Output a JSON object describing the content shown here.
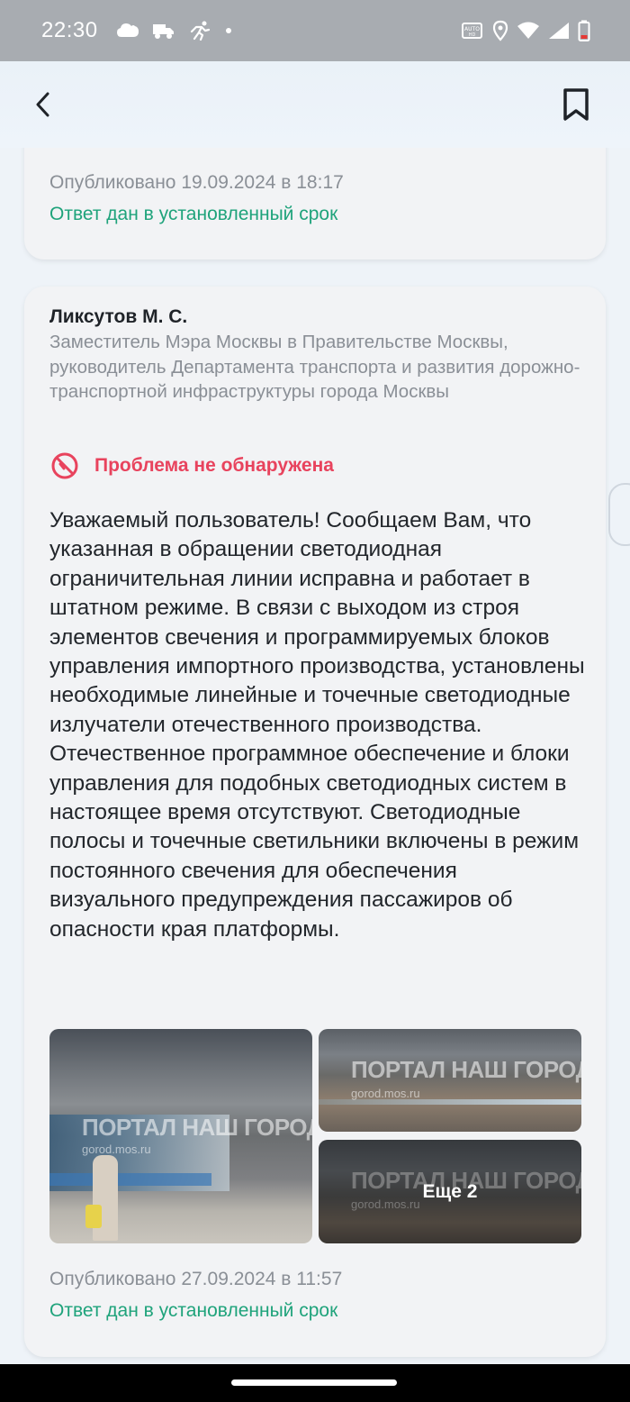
{
  "status_bar": {
    "time": "22:30",
    "left_icons": [
      "cloud-icon",
      "truck-icon",
      "runner-icon",
      "dot-icon"
    ],
    "right_icons": [
      "auto-hd-icon",
      "location-icon",
      "wifi-icon",
      "signal-icon",
      "battery-low-icon"
    ]
  },
  "app_bar": {
    "back_icon": "chevron-left-icon",
    "bookmark_icon": "bookmark-icon"
  },
  "previous_card": {
    "published": "Опубликовано 19.09.2024 в 18:17",
    "deadline": "Ответ дан в установленный срок"
  },
  "answer_card": {
    "author_name": "Ликсутов М. С.",
    "author_title": "Заместитель Мэра Москвы в Правительстве Москвы, руководитель Департамента транспорта и развития  дорожно-транспортной инфраструктуры города Москвы",
    "status_icon": "no-problem-icon",
    "status": "Проблема не обнаружена",
    "status_color": "#e8435d",
    "text": "Уважаемый пользователь! Сообщаем Вам, что указанная в обращении светодиодная ограничительная линии исправна и работает в штатном режиме. В связи с выходом из строя элементов свечения и программируемых блоков управления импортного производства, установлены необходимые линейные и точечные светодиодные излучатели отечественного производства. Отечественное программное обеспечение и блоки управления для подобных светодиодных систем в настоящее время отсутствуют. Светодиодные полосы и точечные светильники включены в режим постоянного свечения для обеспечения визуального предупреждения пассажиров об опасности края платформы.",
    "photos": [
      {
        "watermark": "ПОРТАЛ НАШ ГОРОД",
        "watermark_sub": "gorod.mos.ru"
      },
      {
        "watermark": "ПОРТАЛ НАШ ГОРОД",
        "watermark_sub": "gorod.mos.ru"
      },
      {
        "watermark": "ПОРТАЛ НАШ ГОРОД",
        "watermark_sub": "gorod.mos.ru",
        "more_label": "Еще 2"
      }
    ],
    "published": "Опубликовано 27.09.2024 в 11:57",
    "deadline": "Ответ дан в установленный срок",
    "deadline_color": "#1fa37b"
  }
}
